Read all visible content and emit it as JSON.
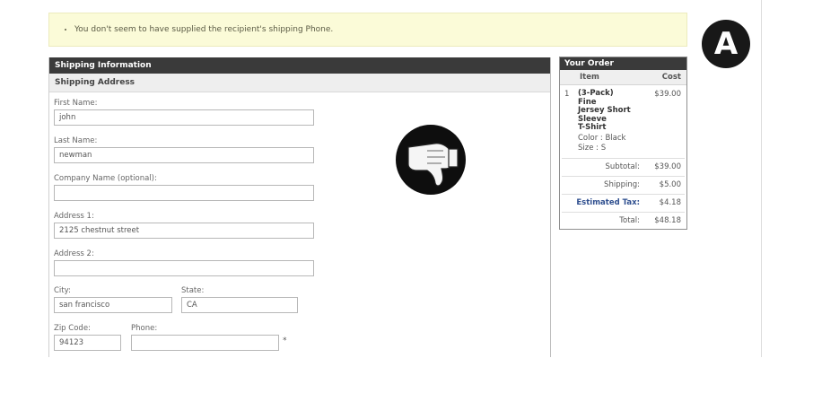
{
  "alert": {
    "message": "You don't seem to have supplied the recipient's shipping Phone."
  },
  "badge": {
    "letter": "A"
  },
  "shipping": {
    "header": "Shipping Information",
    "subheader": "Shipping Address",
    "fields": {
      "first_name": {
        "label": "First Name:",
        "value": "john"
      },
      "last_name": {
        "label": "Last Name:",
        "value": "newman"
      },
      "company": {
        "label": "Company Name (optional):",
        "value": ""
      },
      "address1": {
        "label": "Address 1:",
        "value": "2125 chestnut street"
      },
      "address2": {
        "label": "Address 2:",
        "value": ""
      },
      "city": {
        "label": "City:",
        "value": "san francisco"
      },
      "state": {
        "label": "State:",
        "value": "CA"
      },
      "zip": {
        "label": "Zip Code:",
        "value": "94123"
      },
      "phone": {
        "label": "Phone:",
        "value": ""
      },
      "required_marker": "*"
    }
  },
  "order": {
    "header": "Your Order",
    "col_item": "Item",
    "col_cost": "Cost",
    "items": [
      {
        "qty": "1",
        "name_lines": [
          "(3-Pack)",
          "Fine",
          "Jersey Short",
          "Sleeve",
          "T-Shirt"
        ],
        "color": "Color : Black",
        "size": "Size : S",
        "cost": "$39.00"
      }
    ],
    "subtotal_label": "Subtotal:",
    "subtotal": "$39.00",
    "shipping_label": "Shipping:",
    "shipping": "$5.00",
    "tax_label": "Estimated Tax:",
    "tax": "$4.18",
    "total_label": "Total:",
    "total": "$48.18"
  },
  "icons": {
    "thumb": "thumbs-down-icon"
  }
}
